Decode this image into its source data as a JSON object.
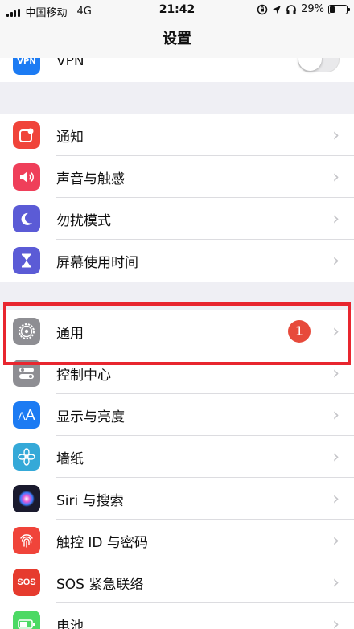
{
  "status_bar": {
    "carrier": "中国移动",
    "network": "4G",
    "time": "21:42",
    "battery_percent_text": "29%",
    "battery_level": 0.29
  },
  "nav": {
    "title": "设置"
  },
  "vpn_row": {
    "label": "VPN",
    "toggle_on": false
  },
  "group1": [
    {
      "label": "通知",
      "icon": "notifications-icon",
      "color": "#f0443a"
    },
    {
      "label": "声音与触感",
      "icon": "sound-icon",
      "color": "#ef3f5a"
    },
    {
      "label": "勿扰模式",
      "icon": "moon-icon",
      "color": "#5b5bd6"
    },
    {
      "label": "屏幕使用时间",
      "icon": "hourglass-icon",
      "color": "#5b5bd6"
    }
  ],
  "group2": [
    {
      "label": "通用",
      "icon": "gear-icon",
      "color": "#8e8e93",
      "badge": "1"
    },
    {
      "label": "控制中心",
      "icon": "toggles-icon",
      "color": "#8e8e93"
    },
    {
      "label": "显示与亮度",
      "icon": "text-size-icon",
      "color": "#1c7bf3"
    },
    {
      "label": "墙纸",
      "icon": "flower-icon",
      "color": "#35a9d8"
    },
    {
      "label": "Siri 与搜索",
      "icon": "siri-icon",
      "color": "#1a1a2e"
    },
    {
      "label": "触控 ID 与密码",
      "icon": "fingerprint-icon",
      "color": "#f0443a"
    },
    {
      "label": "SOS 紧急联络",
      "icon": "sos-icon",
      "color": "#e63b2e"
    },
    {
      "label": "电池",
      "icon": "battery-icon",
      "color": "#4cd964"
    }
  ],
  "accent": {
    "highlight_color": "#e8262f",
    "badge_color": "#e74a3b"
  }
}
